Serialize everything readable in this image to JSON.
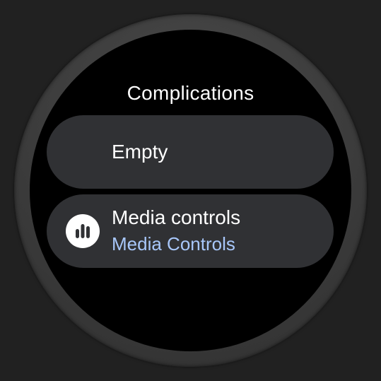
{
  "screen": {
    "title": "Complications"
  },
  "items": [
    {
      "label": "Empty"
    },
    {
      "label": "Media controls",
      "secondary": "Media Controls",
      "icon": "audio-bars-icon"
    }
  ],
  "colors": {
    "background": "#212121",
    "screen": "#000000",
    "chip": "#303134",
    "primary_text": "#ffffff",
    "secondary_text": "#a8c7fa"
  }
}
